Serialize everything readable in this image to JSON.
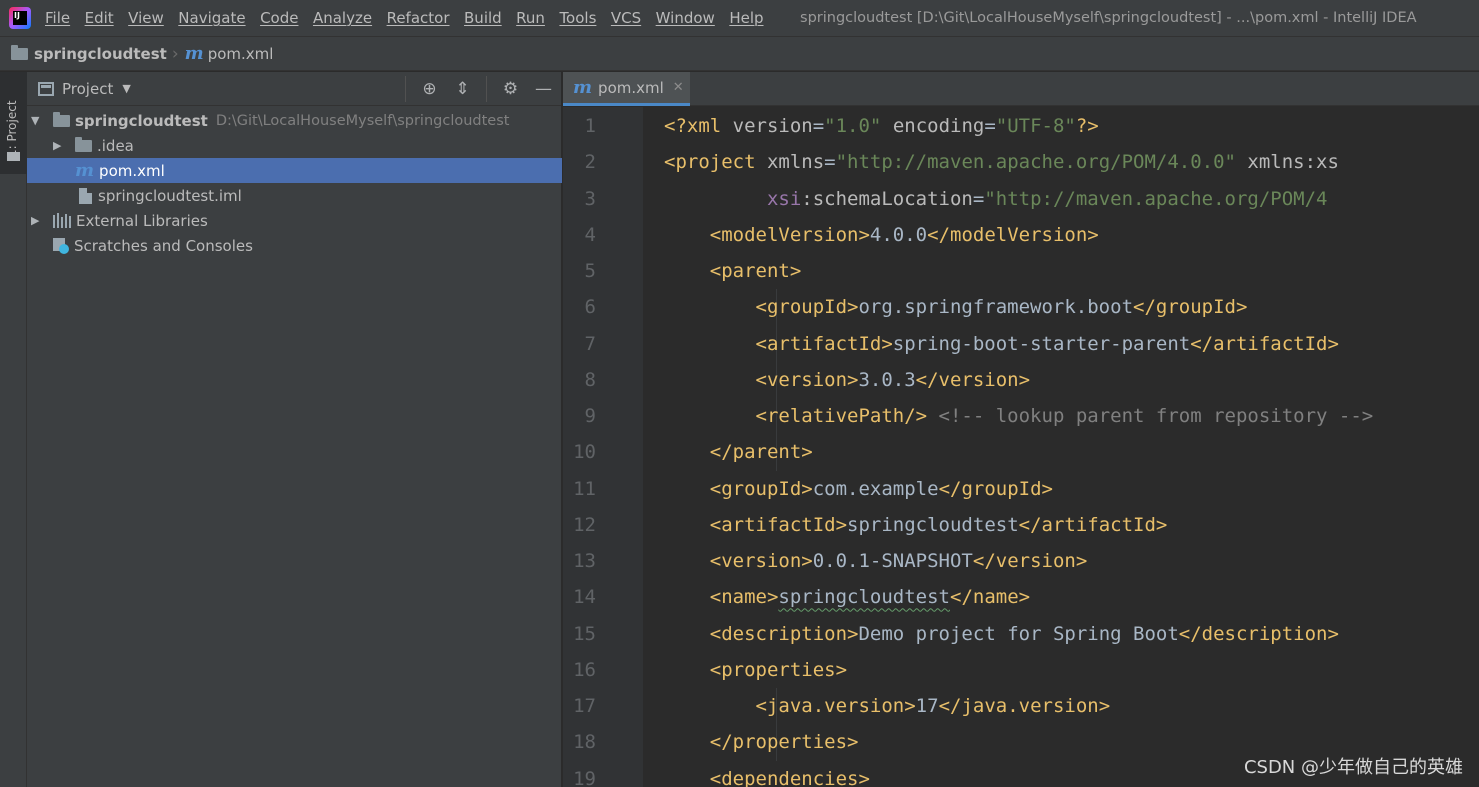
{
  "menubar": {
    "items": [
      "File",
      "Edit",
      "View",
      "Navigate",
      "Code",
      "Analyze",
      "Refactor",
      "Build",
      "Run",
      "Tools",
      "VCS",
      "Window",
      "Help"
    ],
    "window_title": "springcloudtest [D:\\Git\\LocalHouseMyself\\springcloudtest] - ...\\pom.xml - IntelliJ IDEA",
    "logo_text": "IJ"
  },
  "navbar": {
    "project": "springcloudtest",
    "file": "pom.xml"
  },
  "toolstrip": {
    "tab_label": "1: Project"
  },
  "project_panel": {
    "title": "Project",
    "tree": [
      {
        "label": "springcloudtest",
        "path": "D:\\Git\\LocalHouseMyself\\springcloudtest",
        "icon": "module-folder-icon",
        "expanded": true
      },
      {
        "label": ".idea",
        "icon": "folder-icon",
        "expanded": false
      },
      {
        "label": "pom.xml",
        "icon": "maven-icon",
        "selected": true
      },
      {
        "label": "springcloudtest.iml",
        "icon": "iml-file-icon"
      },
      {
        "label": "External Libraries",
        "icon": "library-icon",
        "expanded": false
      },
      {
        "label": "Scratches and Consoles",
        "icon": "scratches-icon"
      }
    ]
  },
  "editor": {
    "tab_label": "pom.xml",
    "line_numbers": [
      "1",
      "2",
      "3",
      "4",
      "5",
      "6",
      "7",
      "8",
      "9",
      "10",
      "11",
      "12",
      "13",
      "14",
      "15",
      "16",
      "17",
      "18",
      "19"
    ],
    "lines": [
      [
        [
          "t-tag",
          "<?xml "
        ],
        [
          "t-attr",
          "version"
        ],
        [
          "t-txt",
          "="
        ],
        [
          "t-val",
          "\"1.0\""
        ],
        [
          "t-attr",
          " encoding"
        ],
        [
          "t-txt",
          "="
        ],
        [
          "t-val",
          "\"UTF-8\""
        ],
        [
          "t-tag",
          "?>"
        ]
      ],
      [
        [
          "t-tag",
          "<project "
        ],
        [
          "t-attr",
          "xmlns"
        ],
        [
          "t-txt",
          "="
        ],
        [
          "t-val",
          "\"http://maven.apache.org/POM/4.0.0\""
        ],
        [
          "t-attr",
          " xmlns:xs"
        ]
      ],
      [
        [
          "t-txt",
          "         "
        ],
        [
          "t-ns",
          "xsi"
        ],
        [
          "t-attr",
          ":schemaLocation"
        ],
        [
          "t-txt",
          "="
        ],
        [
          "t-val",
          "\"http://maven.apache.org/POM/4"
        ]
      ],
      [
        [
          "t-txt",
          "    "
        ],
        [
          "t-tag",
          "<modelVersion>"
        ],
        [
          "t-txt",
          "4.0.0"
        ],
        [
          "t-tag",
          "</modelVersion>"
        ]
      ],
      [
        [
          "t-txt",
          "    "
        ],
        [
          "t-tag",
          "<parent>"
        ]
      ],
      [
        [
          "t-txt",
          "        "
        ],
        [
          "t-tag",
          "<groupId>"
        ],
        [
          "t-txt",
          "org.springframework.boot"
        ],
        [
          "t-tag",
          "</groupId>"
        ]
      ],
      [
        [
          "t-txt",
          "        "
        ],
        [
          "t-tag",
          "<artifactId>"
        ],
        [
          "t-txt",
          "spring-boot-starter-parent"
        ],
        [
          "t-tag",
          "</artifactId>"
        ]
      ],
      [
        [
          "t-txt",
          "        "
        ],
        [
          "t-tag",
          "<version>"
        ],
        [
          "t-txt",
          "3.0.3"
        ],
        [
          "t-tag",
          "</version>"
        ]
      ],
      [
        [
          "t-txt",
          "        "
        ],
        [
          "t-tag",
          "<relativePath/>"
        ],
        [
          "t-cmt",
          " <!-- lookup parent from repository -->"
        ]
      ],
      [
        [
          "t-txt",
          "    "
        ],
        [
          "t-tag",
          "</parent>"
        ]
      ],
      [
        [
          "t-txt",
          "    "
        ],
        [
          "t-tag",
          "<groupId>"
        ],
        [
          "t-txt",
          "com.example"
        ],
        [
          "t-tag",
          "</groupId>"
        ]
      ],
      [
        [
          "t-txt",
          "    "
        ],
        [
          "t-tag",
          "<artifactId>"
        ],
        [
          "t-txt",
          "springcloudtest"
        ],
        [
          "t-tag",
          "</artifactId>"
        ]
      ],
      [
        [
          "t-txt",
          "    "
        ],
        [
          "t-tag",
          "<version>"
        ],
        [
          "t-txt",
          "0.0.1-SNAPSHOT"
        ],
        [
          "t-tag",
          "</version>"
        ]
      ],
      [
        [
          "t-txt",
          "    "
        ],
        [
          "t-tag",
          "<name>"
        ],
        [
          "t-txt t-typo",
          "springcloudtest"
        ],
        [
          "t-tag",
          "</name>"
        ]
      ],
      [
        [
          "t-txt",
          "    "
        ],
        [
          "t-tag",
          "<description>"
        ],
        [
          "t-txt",
          "Demo project for Spring Boot"
        ],
        [
          "t-tag",
          "</description>"
        ]
      ],
      [
        [
          "t-txt",
          "    "
        ],
        [
          "t-tag",
          "<properties>"
        ]
      ],
      [
        [
          "t-txt",
          "        "
        ],
        [
          "t-tag",
          "<java.version>"
        ],
        [
          "t-txt",
          "17"
        ],
        [
          "t-tag",
          "</java.version>"
        ]
      ],
      [
        [
          "t-txt",
          "    "
        ],
        [
          "t-tag",
          "</properties>"
        ]
      ],
      [
        [
          "t-txt",
          "    "
        ],
        [
          "t-tag",
          "<dependencies>"
        ]
      ]
    ]
  },
  "watermark": "CSDN @少年做自己的英雄",
  "colors": {
    "background": "#2b2b2b",
    "panel": "#3c3f41",
    "selection": "#4b6eaf",
    "tag": "#e8bf6a",
    "value": "#6a8759",
    "comment": "#808080"
  }
}
